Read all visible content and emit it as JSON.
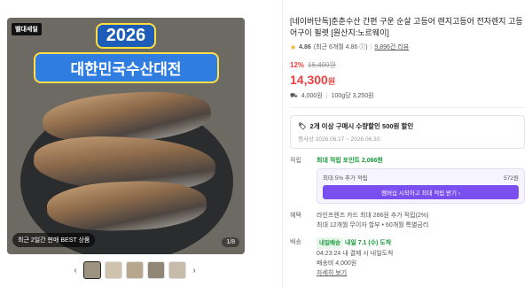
{
  "gallery": {
    "top_badge": "벨대세일",
    "banner_year": "2026",
    "banner_title": "대한민국수산대전",
    "best_badge": "최근 2일간 판매 BEST 상품",
    "page_counter": "1/8",
    "prev_arrow": "‹",
    "next_arrow": "›",
    "thumb_count": 5
  },
  "product": {
    "title": "[네이버단독]춘춘수산 간편 구운 순살 고등어 렌지고등어 전자렌지 고등어구이 필렛 [원산지:노르웨이]",
    "rating": "4.86",
    "rating_detail": "(최근 6개월 4.86 ⓘ)",
    "review_count": "9,896건 리뷰",
    "discount": "12%",
    "original_price": "16,400원",
    "price": "14,300",
    "price_unit": "원",
    "shipping_fee": "4,000원",
    "unit_price": "100g당 3,250원"
  },
  "promo": {
    "text": "2개 이상 구매시 수량할인 500원 할인",
    "period": "행사상 2026.06.17 ~ 2026.06.30."
  },
  "points": {
    "label": "적립",
    "max_points": "최대 적립 포인트 2,066원",
    "card_line": "최대 5% 추가 적립",
    "card_amount": "572원",
    "card_button": "멤버십 시작하고 최대 적립 받기 ›"
  },
  "benefits": {
    "label": "혜택",
    "line1": "라인프렌즈 카드 최대 286원 추가 적립(2%)",
    "line2": "최대 12개월 무이자 할부 • 60개월 특별금리"
  },
  "delivery": {
    "label": "배송",
    "tag": "내일배송",
    "arrival": "내일 7.1 (수) 도착",
    "line2": "04:23:24 내 결제 시 내일도착",
    "line3": "배송비 4,000원",
    "details_link": "자세히 보기"
  },
  "colors": {
    "accent_red": "#f04040",
    "point_green": "#1a9b3c",
    "membership_purple": "#7b4ef0",
    "star": "#f5a623"
  }
}
